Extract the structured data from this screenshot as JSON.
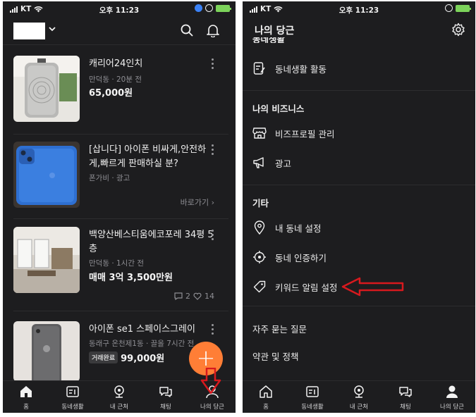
{
  "status_left": {
    "carrier": "KT",
    "time": "오후 11:23"
  },
  "status_right": {
    "carrier": "KT",
    "time": "오후 11:23"
  },
  "colors": {
    "accent": "#ff7e36",
    "background": "#1d1d1f",
    "arrow": "#d7191e"
  },
  "listings": [
    {
      "title": "캐리어24인치",
      "meta": "만덕동 · 20분 전",
      "price": "65,000원",
      "thumb": "suitcase"
    },
    {
      "title": "[삽니다] 아이폰 비싸게,안전하게,빠르게 판매하실 분?",
      "meta": "폰가비 · 광고",
      "link": "바로가기",
      "thumb": "blue-iphone"
    },
    {
      "title": "백양산베스티움에코포레 34평 5층",
      "meta": "만덕동 · 1시간 전",
      "price": "매매 3억 3,500만원",
      "comments": "2",
      "likes": "14",
      "thumb": "apartment"
    },
    {
      "title": "아이폰 se1 스페이스그레이",
      "meta": "동래구 온천제1동 · 끌올 7시간 전",
      "badge": "거래완료",
      "price": "99,000원",
      "thumb": "gray-iphone"
    }
  ],
  "tabbar": [
    {
      "label": "홈",
      "icon": "home-icon"
    },
    {
      "label": "동네생활",
      "icon": "neighborhood-icon"
    },
    {
      "label": "내 근처",
      "icon": "location-pin-icon"
    },
    {
      "label": "채팅",
      "icon": "chat-icon"
    },
    {
      "label": "나의 당근",
      "icon": "profile-icon"
    }
  ],
  "my_page": {
    "title": "나의 당근",
    "clipped_section": "동네생활",
    "neighborhood_activity": "동네생활 활동",
    "business_head": "나의 비즈니스",
    "business_items": [
      "비즈프로필 관리",
      "광고"
    ],
    "etc_head": "기타",
    "etc_items": [
      "내 동네 설정",
      "동네 인증하기",
      "키워드 알림 설정"
    ],
    "faq": "자주 묻는 질문",
    "terms": "약관 및 정책"
  }
}
